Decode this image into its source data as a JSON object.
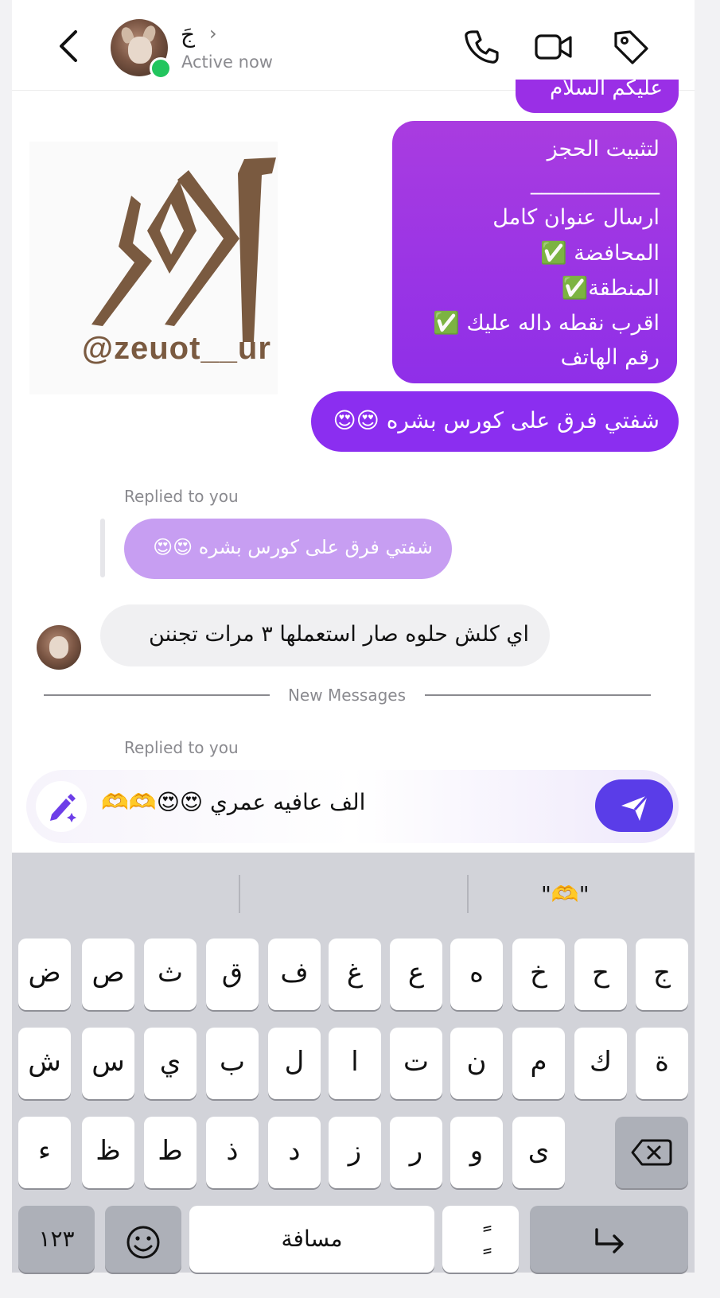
{
  "header": {
    "contact_name": "جَ",
    "status": "Active now"
  },
  "messages": {
    "partial_top": "عليكم السلام",
    "booking": {
      "title": "لتثبيت الحجز",
      "rule": "____________",
      "line1": "ارسال عنوان كامل",
      "line2": "المحافضة ✅",
      "line3": "المنطقة✅",
      "line4": "اقرب نقطه داله عليك ✅",
      "line5": "رقم الهاتف"
    },
    "sent2": "شفتي فرق على كورس بشره 😍😍",
    "replied_label_1": "Replied to you",
    "quoted": "شفتي فرق على كورس بشره 😍😍",
    "received": "اي كلش حلوه صار استعملها ٣ مرات تجننن",
    "new_messages": "New Messages",
    "replied_label_2": "Replied to you"
  },
  "logo": {
    "handle": "@zeuot__ur",
    "mark": "اور",
    "brand_color": "#7a5a40"
  },
  "composer": {
    "text": "الف عافيه عمري 😍😍🫶🫶"
  },
  "keyboard": {
    "suggestion": "\"🫶\"",
    "row1": [
      "ض",
      "ص",
      "ث",
      "ق",
      "ف",
      "غ",
      "ع",
      "ه",
      "خ",
      "ح",
      "ج"
    ],
    "row2": [
      "ش",
      "س",
      "ي",
      "ب",
      "ل",
      "ا",
      "ت",
      "ن",
      "م",
      "ك",
      "ة"
    ],
    "row3": [
      "ء",
      "ظ",
      "ط",
      "ذ",
      "د",
      "ز",
      "ر",
      "و",
      "ى"
    ],
    "numbers_key": "١٢٣",
    "space_key": "مسافة",
    "diacritic_key": "ًٍ"
  },
  "colors": {
    "sent_bubble": "#8f2fe8",
    "quote_bubble": "#c79ef2",
    "send_button": "#5a3de8",
    "online": "#22c55e"
  }
}
